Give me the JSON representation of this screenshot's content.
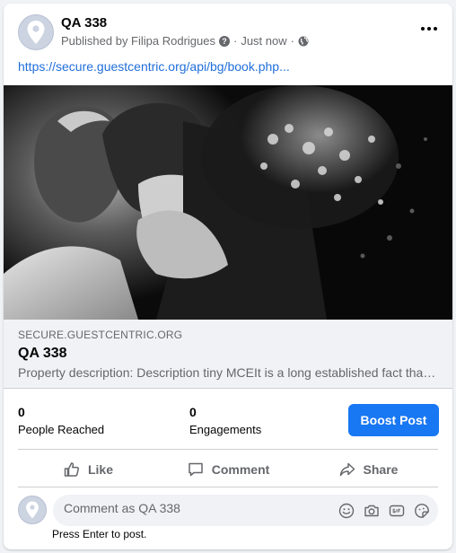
{
  "post": {
    "page_name": "QA 338",
    "published_by": "Published by Filipa Rodrigues",
    "help_glyph": "?",
    "separator": "·",
    "time": "Just now",
    "link_text": "https://secure.guestcentric.org/api/bg/book.php..."
  },
  "preview": {
    "domain": "SECURE.GUESTCENTRIC.ORG",
    "title": "QA 338",
    "description": "Property description: Description tiny MCEIt is a long established fact that a reader will be distracted"
  },
  "stats": {
    "reached_value": "0",
    "reached_label": "People Reached",
    "engagements_value": "0",
    "engagements_label": "Engagements",
    "boost_label": "Boost Post"
  },
  "actions": {
    "like": "Like",
    "comment": "Comment",
    "share": "Share"
  },
  "comment": {
    "placeholder": "Comment as QA 338",
    "hint": "Press Enter to post."
  },
  "icons": [
    "location-pin-icon",
    "globe-icon",
    "more-icon",
    "like-icon",
    "comment-icon",
    "share-icon",
    "emoji-icon",
    "camera-icon",
    "gif-icon",
    "sticker-icon"
  ],
  "colors": {
    "accent": "#1877f2",
    "link": "#216fdb",
    "muted": "#65676b",
    "preview_bg": "#f0f2f5"
  }
}
